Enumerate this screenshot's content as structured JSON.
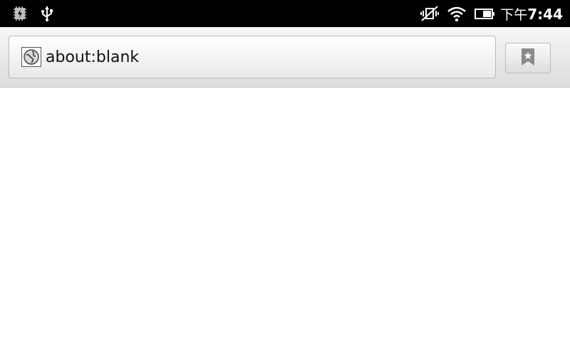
{
  "status_bar": {
    "clock_ampm": "下午",
    "clock_time": "7:44",
    "icons": [
      "debug-icon",
      "usb-icon",
      "vibrate-silent-icon",
      "wifi-icon",
      "battery-icon"
    ]
  },
  "toolbar": {
    "url": "about:blank",
    "favicon": "globe-icon",
    "bookmark_icon": "bookmark-star-icon"
  },
  "colors": {
    "status_bar_bg": "#000000",
    "toolbar_bg": "#e6e6e6",
    "content_bg": "#ffffff"
  }
}
